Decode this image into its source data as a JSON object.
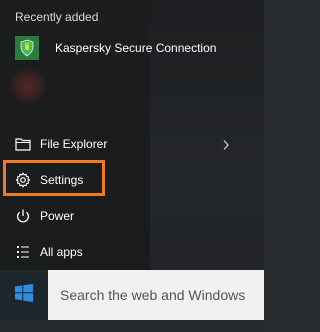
{
  "start_menu": {
    "recently_added_label": "Recently added",
    "recent_apps": [
      {
        "label": "Kaspersky Secure Connection",
        "icon": "kaspersky-shield-icon",
        "tile_color": "#2c7a3c"
      }
    ],
    "items": {
      "file_explorer": {
        "label": "File Explorer",
        "icon": "folder-icon"
      },
      "settings": {
        "label": "Settings",
        "icon": "gear-icon"
      },
      "power": {
        "label": "Power",
        "icon": "power-icon"
      },
      "all_apps": {
        "label": "All apps",
        "icon": "list-icon"
      }
    },
    "highlight_color": "#f07a24"
  },
  "taskbar": {
    "start_icon": "windows-logo-icon",
    "search_placeholder": "Search the web and Windows"
  }
}
